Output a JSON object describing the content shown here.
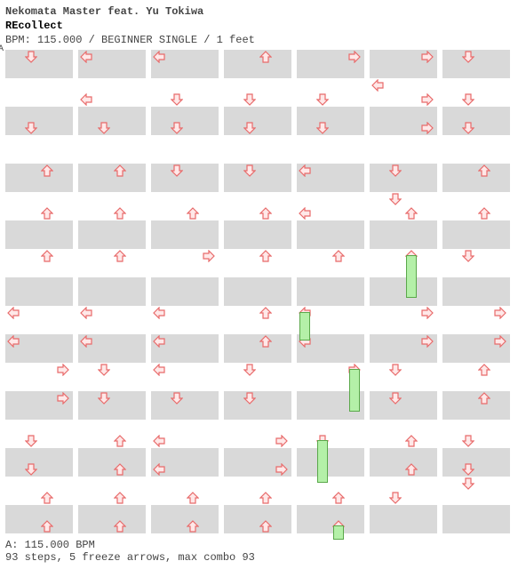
{
  "header": {
    "artist": "Nekomata Master feat. Yu Tokiwa",
    "title": "REcollect",
    "meta": "BPM: 115.000 / BEGINNER SINGLE / 1 feet",
    "marker": "A"
  },
  "footer": {
    "bpm_line": "A: 115.000 BPM",
    "stats": "93 steps, 5 freeze arrows, max combo 93"
  },
  "colors": {
    "arrow_stroke": "#e86a6a",
    "arrow_fill": "#ffe8e8",
    "freeze_fill": "#b4f0a8",
    "freeze_stroke": "#5aa84a"
  },
  "layout": {
    "columns": 7,
    "rows_per_column": 34
  },
  "arrows": [
    {
      "col": 0,
      "row": 0,
      "lane": 1,
      "dir": "D"
    },
    {
      "col": 0,
      "row": 5,
      "lane": 1,
      "dir": "D"
    },
    {
      "col": 0,
      "row": 8,
      "lane": 2,
      "dir": "U"
    },
    {
      "col": 0,
      "row": 11,
      "lane": 2,
      "dir": "U"
    },
    {
      "col": 0,
      "row": 14,
      "lane": 2,
      "dir": "U"
    },
    {
      "col": 0,
      "row": 18,
      "lane": 0,
      "dir": "L"
    },
    {
      "col": 0,
      "row": 20,
      "lane": 0,
      "dir": "L"
    },
    {
      "col": 0,
      "row": 22,
      "lane": 3,
      "dir": "R"
    },
    {
      "col": 0,
      "row": 24,
      "lane": 3,
      "dir": "R"
    },
    {
      "col": 0,
      "row": 27,
      "lane": 1,
      "dir": "D"
    },
    {
      "col": 0,
      "row": 29,
      "lane": 1,
      "dir": "D"
    },
    {
      "col": 0,
      "row": 31,
      "lane": 2,
      "dir": "U"
    },
    {
      "col": 0,
      "row": 33,
      "lane": 2,
      "dir": "U"
    },
    {
      "col": 1,
      "row": 0,
      "lane": 0,
      "dir": "L"
    },
    {
      "col": 1,
      "row": 3,
      "lane": 0,
      "dir": "L"
    },
    {
      "col": 1,
      "row": 5,
      "lane": 1,
      "dir": "D"
    },
    {
      "col": 1,
      "row": 8,
      "lane": 2,
      "dir": "U"
    },
    {
      "col": 1,
      "row": 11,
      "lane": 2,
      "dir": "U"
    },
    {
      "col": 1,
      "row": 14,
      "lane": 2,
      "dir": "U"
    },
    {
      "col": 1,
      "row": 18,
      "lane": 0,
      "dir": "L"
    },
    {
      "col": 1,
      "row": 20,
      "lane": 0,
      "dir": "L"
    },
    {
      "col": 1,
      "row": 22,
      "lane": 1,
      "dir": "D"
    },
    {
      "col": 1,
      "row": 24,
      "lane": 1,
      "dir": "D"
    },
    {
      "col": 1,
      "row": 27,
      "lane": 2,
      "dir": "U"
    },
    {
      "col": 1,
      "row": 29,
      "lane": 2,
      "dir": "U"
    },
    {
      "col": 1,
      "row": 31,
      "lane": 2,
      "dir": "U"
    },
    {
      "col": 1,
      "row": 33,
      "lane": 2,
      "dir": "U"
    },
    {
      "col": 2,
      "row": 0,
      "lane": 0,
      "dir": "L"
    },
    {
      "col": 2,
      "row": 3,
      "lane": 1,
      "dir": "D"
    },
    {
      "col": 2,
      "row": 5,
      "lane": 1,
      "dir": "D"
    },
    {
      "col": 2,
      "row": 8,
      "lane": 1,
      "dir": "D"
    },
    {
      "col": 2,
      "row": 11,
      "lane": 2,
      "dir": "U"
    },
    {
      "col": 2,
      "row": 14,
      "lane": 3,
      "dir": "R"
    },
    {
      "col": 2,
      "row": 18,
      "lane": 0,
      "dir": "L"
    },
    {
      "col": 2,
      "row": 20,
      "lane": 0,
      "dir": "L"
    },
    {
      "col": 2,
      "row": 22,
      "lane": 0,
      "dir": "L"
    },
    {
      "col": 2,
      "row": 24,
      "lane": 1,
      "dir": "D"
    },
    {
      "col": 2,
      "row": 27,
      "lane": 0,
      "dir": "L"
    },
    {
      "col": 2,
      "row": 29,
      "lane": 0,
      "dir": "L"
    },
    {
      "col": 2,
      "row": 31,
      "lane": 2,
      "dir": "U"
    },
    {
      "col": 2,
      "row": 33,
      "lane": 2,
      "dir": "U"
    },
    {
      "col": 3,
      "row": 0,
      "lane": 2,
      "dir": "U"
    },
    {
      "col": 3,
      "row": 3,
      "lane": 1,
      "dir": "D"
    },
    {
      "col": 3,
      "row": 5,
      "lane": 1,
      "dir": "D"
    },
    {
      "col": 3,
      "row": 8,
      "lane": 1,
      "dir": "D"
    },
    {
      "col": 3,
      "row": 11,
      "lane": 2,
      "dir": "U"
    },
    {
      "col": 3,
      "row": 14,
      "lane": 2,
      "dir": "U"
    },
    {
      "col": 3,
      "row": 18,
      "lane": 2,
      "dir": "U"
    },
    {
      "col": 3,
      "row": 20,
      "lane": 2,
      "dir": "U"
    },
    {
      "col": 3,
      "row": 22,
      "lane": 1,
      "dir": "D"
    },
    {
      "col": 3,
      "row": 24,
      "lane": 1,
      "dir": "D"
    },
    {
      "col": 3,
      "row": 27,
      "lane": 3,
      "dir": "R"
    },
    {
      "col": 3,
      "row": 29,
      "lane": 3,
      "dir": "R"
    },
    {
      "col": 3,
      "row": 31,
      "lane": 2,
      "dir": "U"
    },
    {
      "col": 3,
      "row": 33,
      "lane": 2,
      "dir": "U"
    },
    {
      "col": 4,
      "row": 0,
      "lane": 3,
      "dir": "R"
    },
    {
      "col": 4,
      "row": 3,
      "lane": 1,
      "dir": "D"
    },
    {
      "col": 4,
      "row": 5,
      "lane": 1,
      "dir": "D"
    },
    {
      "col": 4,
      "row": 8,
      "lane": 0,
      "dir": "L"
    },
    {
      "col": 4,
      "row": 11,
      "lane": 0,
      "dir": "L"
    },
    {
      "col": 4,
      "row": 14,
      "lane": 2,
      "dir": "U"
    },
    {
      "col": 4,
      "row": 18,
      "lane": 0,
      "dir": "L"
    },
    {
      "col": 4,
      "row": 20,
      "lane": 0,
      "dir": "L"
    },
    {
      "col": 4,
      "row": 22,
      "lane": 3,
      "dir": "R"
    },
    {
      "col": 4,
      "row": 27,
      "lane": 1,
      "dir": "D"
    },
    {
      "col": 4,
      "row": 31,
      "lane": 2,
      "dir": "U"
    },
    {
      "col": 4,
      "row": 33,
      "lane": 2,
      "dir": "U"
    },
    {
      "col": 5,
      "row": 0,
      "lane": 3,
      "dir": "R"
    },
    {
      "col": 5,
      "row": 2,
      "lane": 0,
      "dir": "L"
    },
    {
      "col": 5,
      "row": 3,
      "lane": 3,
      "dir": "R"
    },
    {
      "col": 5,
      "row": 5,
      "lane": 3,
      "dir": "R"
    },
    {
      "col": 5,
      "row": 8,
      "lane": 1,
      "dir": "D"
    },
    {
      "col": 5,
      "row": 10,
      "lane": 1,
      "dir": "D"
    },
    {
      "col": 5,
      "row": 11,
      "lane": 2,
      "dir": "U"
    },
    {
      "col": 5,
      "row": 14,
      "lane": 2,
      "dir": "U"
    },
    {
      "col": 5,
      "row": 18,
      "lane": 3,
      "dir": "R"
    },
    {
      "col": 5,
      "row": 20,
      "lane": 3,
      "dir": "R"
    },
    {
      "col": 5,
      "row": 22,
      "lane": 1,
      "dir": "D"
    },
    {
      "col": 5,
      "row": 24,
      "lane": 1,
      "dir": "D"
    },
    {
      "col": 5,
      "row": 27,
      "lane": 2,
      "dir": "U"
    },
    {
      "col": 5,
      "row": 29,
      "lane": 2,
      "dir": "U"
    },
    {
      "col": 5,
      "row": 31,
      "lane": 1,
      "dir": "D"
    },
    {
      "col": 6,
      "row": 0,
      "lane": 1,
      "dir": "D"
    },
    {
      "col": 6,
      "row": 3,
      "lane": 1,
      "dir": "D"
    },
    {
      "col": 6,
      "row": 5,
      "lane": 1,
      "dir": "D"
    },
    {
      "col": 6,
      "row": 8,
      "lane": 2,
      "dir": "U"
    },
    {
      "col": 6,
      "row": 11,
      "lane": 2,
      "dir": "U"
    },
    {
      "col": 6,
      "row": 14,
      "lane": 1,
      "dir": "D"
    },
    {
      "col": 6,
      "row": 18,
      "lane": 3,
      "dir": "R"
    },
    {
      "col": 6,
      "row": 20,
      "lane": 3,
      "dir": "R"
    },
    {
      "col": 6,
      "row": 22,
      "lane": 2,
      "dir": "U"
    },
    {
      "col": 6,
      "row": 24,
      "lane": 2,
      "dir": "U"
    },
    {
      "col": 6,
      "row": 27,
      "lane": 1,
      "dir": "D"
    },
    {
      "col": 6,
      "row": 29,
      "lane": 1,
      "dir": "D"
    },
    {
      "col": 6,
      "row": 30,
      "lane": 1,
      "dir": "D"
    }
  ],
  "freezes": [
    {
      "col": 4,
      "lane": 0,
      "row_start": 18,
      "row_end": 20
    },
    {
      "col": 4,
      "lane": 3,
      "row_start": 22,
      "row_end": 25
    },
    {
      "col": 4,
      "lane": 1,
      "row_start": 27,
      "row_end": 30
    },
    {
      "col": 4,
      "lane": 2,
      "row_start": 33,
      "row_end": 34
    },
    {
      "col": 5,
      "lane": 2,
      "row_start": 14,
      "row_end": 17
    }
  ]
}
